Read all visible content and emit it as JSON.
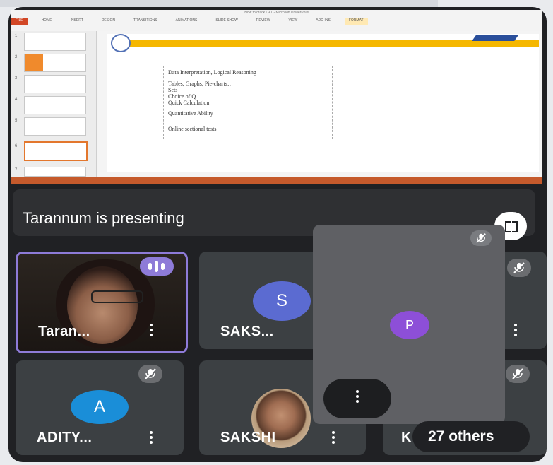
{
  "presentation": {
    "window_title": "How to crack CAT - Microsoft PowerPoint",
    "tabs": [
      "FILE",
      "HOME",
      "INSERT",
      "DESIGN",
      "TRANSITIONS",
      "ANIMATIONS",
      "SLIDE SHOW",
      "REVIEW",
      "VIEW",
      "ADD-INS",
      "FORMAT"
    ],
    "thumbnails": [
      "1",
      "2",
      "3",
      "4",
      "5",
      "6",
      "7"
    ],
    "selected_thumbnail": "6",
    "slide_lines": [
      "Data Interpretation, Logical Reasoning",
      "Tables, Graphs, Pie-charts…",
      "Sets",
      "Choice of Q",
      "Quick Calculation",
      "Quantitative Ability",
      "Online sectional tests"
    ]
  },
  "presenting_label": "Tarannum is presenting",
  "participants": [
    {
      "name": "Taran...",
      "tile": "speaker"
    },
    {
      "name": "SAKS...",
      "initial": "S",
      "avatar_color": "#5b6bd1"
    },
    {
      "name": "ADITY...",
      "initial": "A",
      "avatar_color": "#1a8ed8"
    },
    {
      "name": "SAKSHI"
    },
    {
      "name": "K"
    }
  ],
  "floating_tile": {
    "initial": "P",
    "avatar_color": "#8d4fd8"
  },
  "others_label": "27 others",
  "icons": {
    "mute": "mic-off-icon",
    "more": "more-vert-icon",
    "fullscreen": "fullscreen-icon",
    "talking": "audio-level-icon"
  },
  "colors": {
    "meet_bg": "#202124",
    "tile_bg": "#3c4043",
    "speaker_border": "#8e7bd8",
    "slide_band": "#f5b700"
  }
}
